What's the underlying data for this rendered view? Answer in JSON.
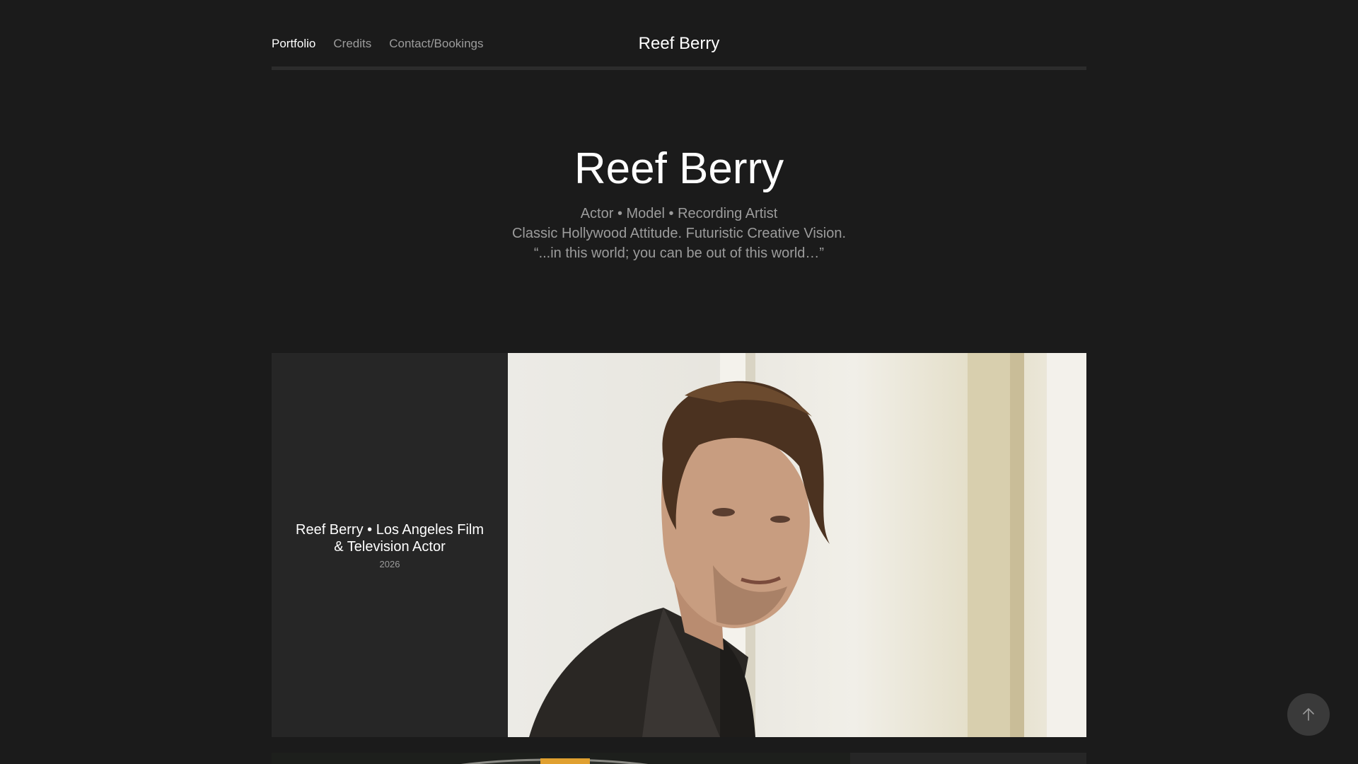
{
  "nav": {
    "items": [
      {
        "label": "Portfolio",
        "active": true
      },
      {
        "label": "Credits",
        "active": false
      },
      {
        "label": "Contact/Bookings",
        "active": false
      }
    ]
  },
  "site": {
    "title": "Reef Berry"
  },
  "hero": {
    "name": "Reef Berry",
    "tagline": "Actor • Model • Recording Artist",
    "subtitle": "Classic Hollywood Attitude. Futuristic Creative Vision.",
    "quote": "“...in this world; you can be out of this world…”"
  },
  "projects": [
    {
      "title": "Reef Berry • Los Angeles Film & Television Actor",
      "year": "2026"
    }
  ],
  "icons": {
    "back_to_top": "arrow-up-icon"
  },
  "colors": {
    "background": "#1b1b1b",
    "card": "#262626",
    "text_primary": "#ffffff",
    "text_muted": "#9c9c9c"
  }
}
